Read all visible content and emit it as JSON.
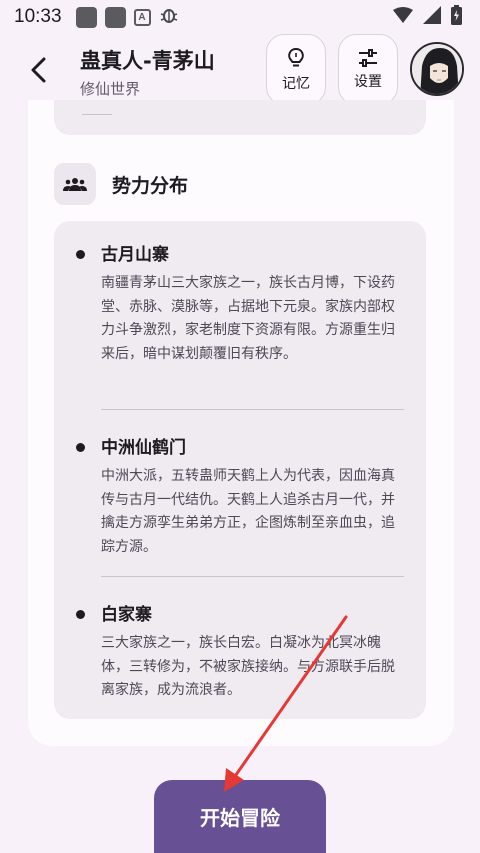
{
  "status_bar": {
    "time": "10:33",
    "left_icons": [
      "notification-square-icon",
      "notification-square-icon",
      "a-app-icon",
      "bug-icon"
    ],
    "right_icons": [
      "wifi-icon",
      "signal-icon",
      "battery-charging-icon"
    ]
  },
  "header": {
    "title": "蛊真人-青茅山",
    "subtitle": "修仙世界",
    "memory_label": "记忆",
    "settings_label": "设置"
  },
  "section": {
    "title": "势力分布",
    "icon": "groups-icon"
  },
  "factions": [
    {
      "name": "古月山寨",
      "description": "南疆青茅山三大家族之一，族长古月博，下设药堂、赤脉、漠脉等，占据地下元泉。家族内部权力斗争激烈，家老制度下资源有限。方源重生归来后，暗中谋划颠覆旧有秩序。"
    },
    {
      "name": "中洲仙鹤门",
      "description": "中洲大派，五转蛊师天鹤上人为代表，因血海真传与古月一代结仇。天鹤上人追杀古月一代，并擒走方源孪生弟弟方正，企图炼制至亲血虫，追踪方源。"
    },
    {
      "name": "白家寨",
      "description": "三大家族之一，族长白宏。白凝冰为北冥冰魄体，三转修为，不被家族接纳。与方源联手后脱离家族，成为流浪者。"
    }
  ],
  "start_button": {
    "label": "开始冒险"
  },
  "colors": {
    "background": "#f8f1f9",
    "card": "#fdfbfd",
    "panel": "#efebf1",
    "accent": "#675094",
    "annotation_arrow": "#e53935"
  }
}
